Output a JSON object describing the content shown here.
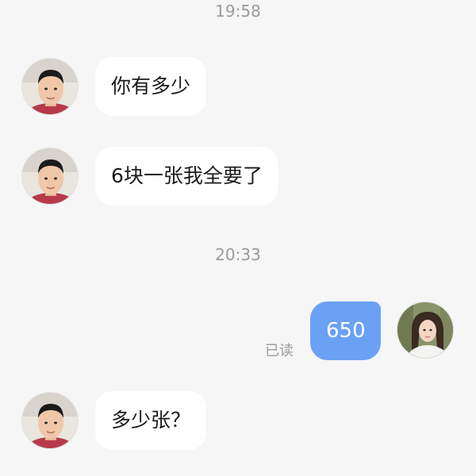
{
  "timestamps": [
    "19:58",
    "20:33"
  ],
  "messages": [
    {
      "sender": "contact",
      "text": "你有多少"
    },
    {
      "sender": "contact",
      "text": "6块一张我全要了"
    },
    {
      "sender": "self",
      "text": "650",
      "status": "已读"
    },
    {
      "sender": "contact",
      "text": "多少张？"
    }
  ],
  "colors": {
    "background": "#f6f6f6",
    "incoming_bubble": "#ffffff",
    "outgoing_bubble": "#6aa1f4",
    "timestamp_text": "#9a9a9a"
  }
}
